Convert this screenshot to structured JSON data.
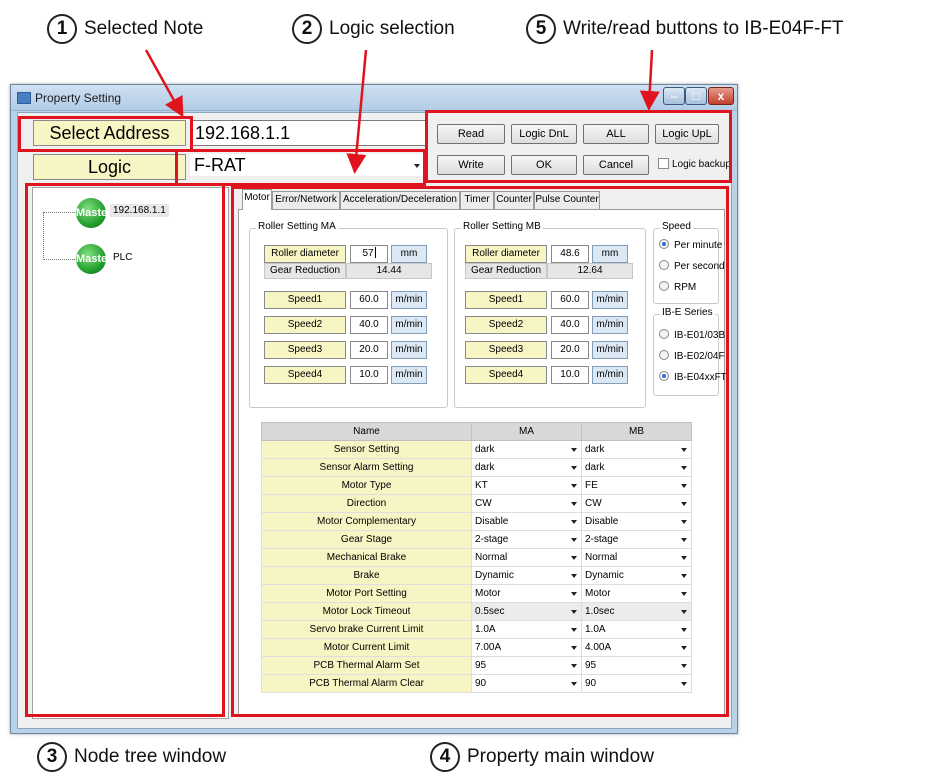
{
  "callouts": [
    {
      "num": "1",
      "label": "Selected Note"
    },
    {
      "num": "2",
      "label": "Logic selection"
    },
    {
      "num": "5",
      "label": "Write/read buttons to IB-E04F-FT"
    },
    {
      "num": "3",
      "label": "Node tree window"
    },
    {
      "num": "4",
      "label": "Property main window"
    }
  ],
  "window": {
    "title": "Property Setting",
    "minimize": "–",
    "maximize": "□",
    "close": "x"
  },
  "header": {
    "select_address_label": "Select Address",
    "address_value": "192.168.1.1",
    "logic_label": "Logic",
    "logic_value": "F-RAT"
  },
  "buttons": {
    "read": "Read",
    "logic_dnl": "Logic DnL",
    "all": "ALL",
    "logic_upl": "Logic UpL",
    "write": "Write",
    "ok": "OK",
    "cancel": "Cancel",
    "logic_backup": "Logic backup"
  },
  "tree": {
    "logo_text": "Master",
    "nodes": [
      {
        "label": "192.168.1.1"
      },
      {
        "label": "PLC"
      }
    ]
  },
  "tabs": [
    "Motor",
    "Error/Network",
    "Acceleration/Deceleration",
    "Timer",
    "Counter",
    "Pulse Counter"
  ],
  "roller_ma": {
    "title": "Roller Setting MA",
    "diameter_label": "Roller diameter",
    "diameter_value": "57",
    "diameter_unit": "mm",
    "gear_label": "Gear Reduction",
    "gear_value": "14.44",
    "speeds": [
      {
        "label": "Speed1",
        "value": "60.0",
        "unit": "m/min"
      },
      {
        "label": "Speed2",
        "value": "40.0",
        "unit": "m/min"
      },
      {
        "label": "Speed3",
        "value": "20.0",
        "unit": "m/min"
      },
      {
        "label": "Speed4",
        "value": "10.0",
        "unit": "m/min"
      }
    ]
  },
  "roller_mb": {
    "title": "Roller Setting MB",
    "diameter_label": "Roller diameter",
    "diameter_value": "48.6",
    "diameter_unit": "mm",
    "gear_label": "Gear Reduction",
    "gear_value": "12.64",
    "speeds": [
      {
        "label": "Speed1",
        "value": "60.0",
        "unit": "m/min"
      },
      {
        "label": "Speed2",
        "value": "40.0",
        "unit": "m/min"
      },
      {
        "label": "Speed3",
        "value": "20.0",
        "unit": "m/min"
      },
      {
        "label": "Speed4",
        "value": "10.0",
        "unit": "m/min"
      }
    ]
  },
  "speed_group": {
    "title": "Speed",
    "options": [
      "Per minute",
      "Per second",
      "RPM"
    ],
    "selected": "Per minute"
  },
  "series_group": {
    "title": "IB-E Series",
    "options": [
      "IB-E01/03B",
      "IB-E02/04F",
      "IB-E04xxFT"
    ],
    "selected": "IB-E04xxFT"
  },
  "property_table": {
    "headers": [
      "Name",
      "MA",
      "MB"
    ],
    "rows": [
      {
        "name": "Sensor Setting",
        "ma": "dark",
        "mb": "dark"
      },
      {
        "name": "Sensor Alarm Setting",
        "ma": "dark",
        "mb": "dark"
      },
      {
        "name": "Motor Type",
        "ma": "KT",
        "mb": "FE"
      },
      {
        "name": "Direction",
        "ma": "CW",
        "mb": "CW"
      },
      {
        "name": "Motor Complementary",
        "ma": "Disable",
        "mb": "Disable"
      },
      {
        "name": "Gear Stage",
        "ma": "2-stage",
        "mb": "2-stage"
      },
      {
        "name": "Mechanical Brake",
        "ma": "Normal",
        "mb": "Normal"
      },
      {
        "name": "Brake",
        "ma": "Dynamic",
        "mb": "Dynamic"
      },
      {
        "name": "Motor Port Setting",
        "ma": "Motor",
        "mb": "Motor"
      },
      {
        "name": "Motor Lock Timeout",
        "ma": "0.5sec",
        "mb": "1.0sec"
      },
      {
        "name": "Servo brake Current Limit",
        "ma": "1.0A",
        "mb": "1.0A"
      },
      {
        "name": "Motor Current Limit",
        "ma": "7.00A",
        "mb": "4.00A"
      },
      {
        "name": "PCB Thermal Alarm Set",
        "ma": "95",
        "mb": "95"
      },
      {
        "name": "PCB Thermal Alarm Clear",
        "ma": "90",
        "mb": "90"
      }
    ]
  }
}
